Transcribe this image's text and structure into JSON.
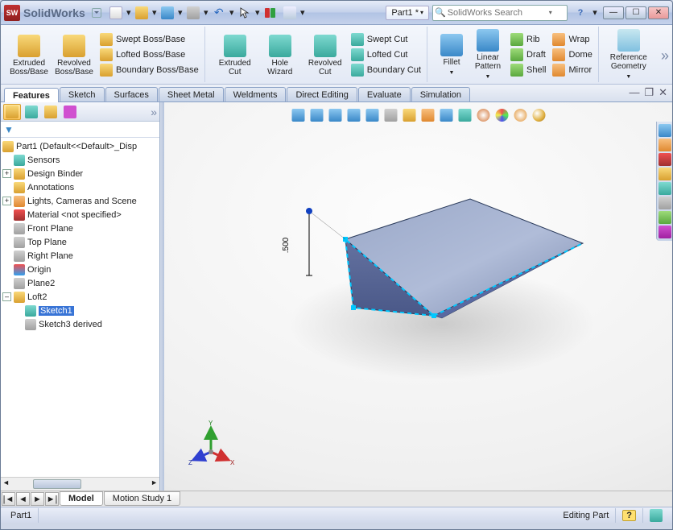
{
  "app": {
    "name": "SolidWorks",
    "logo_text": "SW"
  },
  "quick": {
    "doc_title": "Part1 *",
    "search_placeholder": "SolidWorks Search",
    "help": "?"
  },
  "ribbon": {
    "extruded_boss": "Extruded Boss/Base",
    "revolved_boss": "Revolved Boss/Base",
    "swept_boss": "Swept Boss/Base",
    "lofted_boss": "Lofted Boss/Base",
    "boundary_boss": "Boundary Boss/Base",
    "extruded_cut": "Extruded Cut",
    "hole_wizard": "Hole Wizard",
    "revolved_cut": "Revolved Cut",
    "swept_cut": "Swept Cut",
    "lofted_cut": "Lofted Cut",
    "boundary_cut": "Boundary Cut",
    "fillet": "Fillet",
    "linear_pattern": "Linear Pattern",
    "rib": "Rib",
    "draft": "Draft",
    "shell": "Shell",
    "wrap": "Wrap",
    "dome": "Dome",
    "mirror": "Mirror",
    "ref_geom": "Reference Geometry"
  },
  "tabs": {
    "features": "Features",
    "sketch": "Sketch",
    "surfaces": "Surfaces",
    "sheet_metal": "Sheet Metal",
    "weldments": "Weldments",
    "direct_editing": "Direct Editing",
    "evaluate": "Evaluate",
    "simulation": "Simulation"
  },
  "tree": {
    "root": "Part1  (Default<<Default>_Disp",
    "sensors": "Sensors",
    "design_binder": "Design Binder",
    "annotations": "Annotations",
    "lights": "Lights, Cameras and Scene",
    "material": "Material <not specified>",
    "front_plane": "Front Plane",
    "top_plane": "Top Plane",
    "right_plane": "Right Plane",
    "origin": "Origin",
    "plane2": "Plane2",
    "loft2": "Loft2",
    "sketch1": "Sketch1",
    "sketch3d": "Sketch3 derived"
  },
  "viewport": {
    "dimension": ".500",
    "axes": {
      "x": "X",
      "y": "Y",
      "z": "Z"
    }
  },
  "bottom_tabs": {
    "model": "Model",
    "motion": "Motion Study 1"
  },
  "status": {
    "left": "Part1",
    "mode": "Editing Part"
  },
  "colors": {
    "accent_blue": "#3874d6",
    "panel_border": "#9fb1cc"
  }
}
